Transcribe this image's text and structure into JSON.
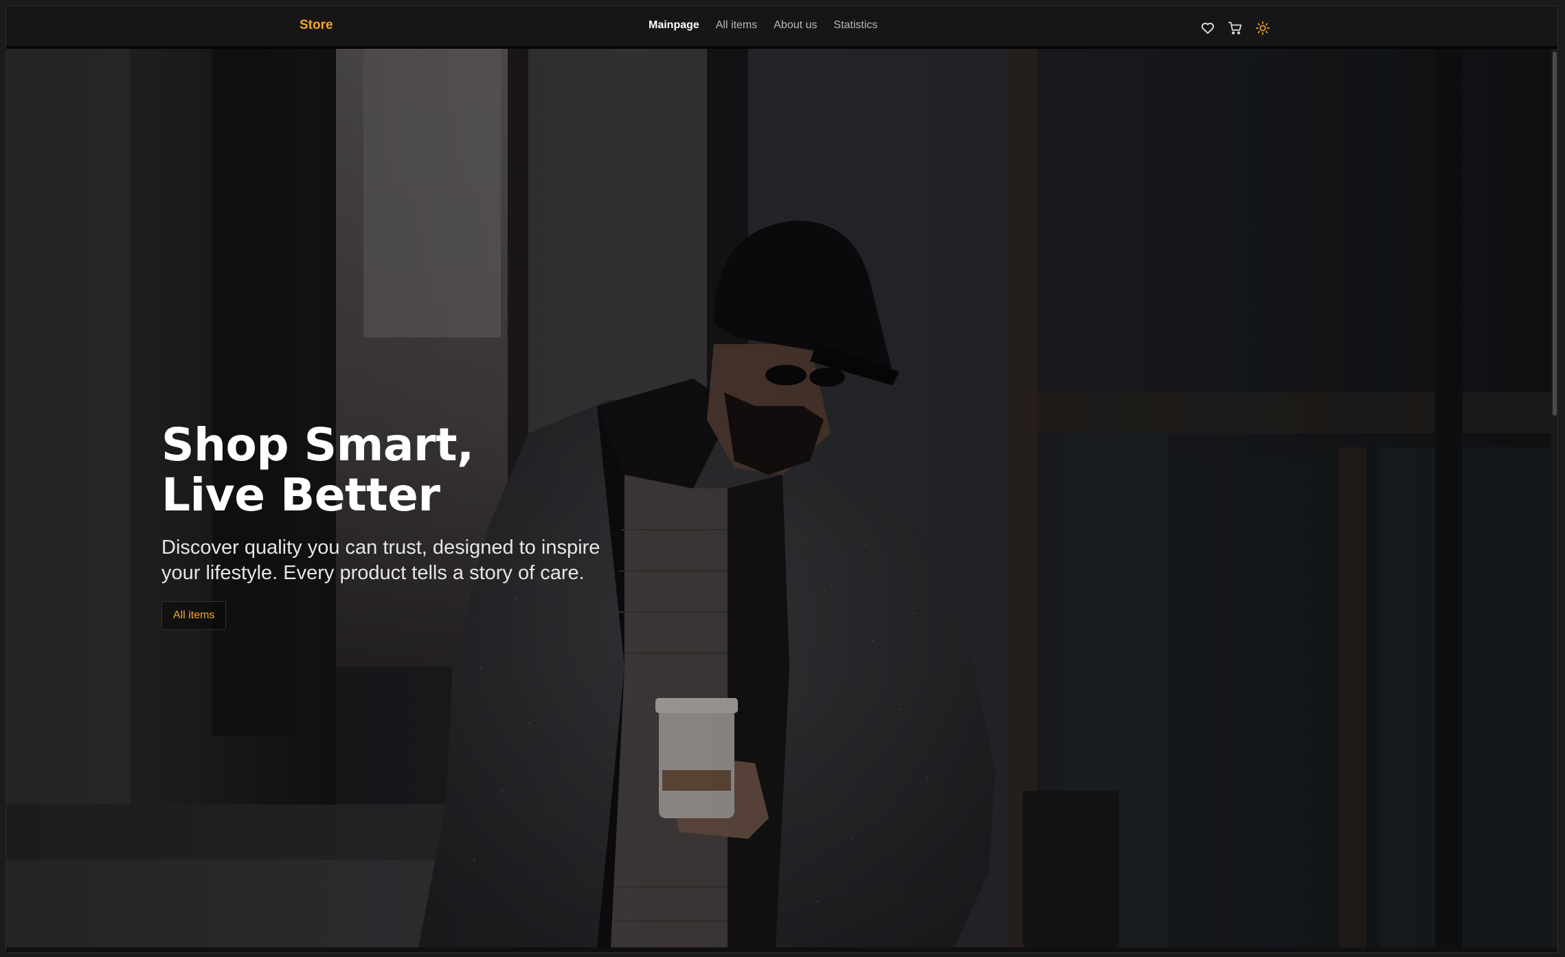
{
  "navbar": {
    "brand": "Store",
    "links": [
      {
        "label": "Mainpage",
        "active": true
      },
      {
        "label": "All items",
        "active": false
      },
      {
        "label": "About us",
        "active": false
      },
      {
        "label": "Statistics",
        "active": false
      }
    ],
    "icons": [
      "heart-icon",
      "cart-icon",
      "sun-icon"
    ]
  },
  "hero": {
    "title_line1": "Shop Smart,",
    "title_line2": "Live Better",
    "subtitle_line1": "Discover quality you can trust, designed to inspire",
    "subtitle_line2": "your lifestyle. Every product tells a story of care.",
    "button_label": "All items",
    "image_description_icon": "hero-photo"
  },
  "colors": {
    "accent": "#f5a623",
    "navbar_bg": "#161616",
    "text_primary": "#ffffff",
    "text_muted": "#b9b9b9"
  }
}
